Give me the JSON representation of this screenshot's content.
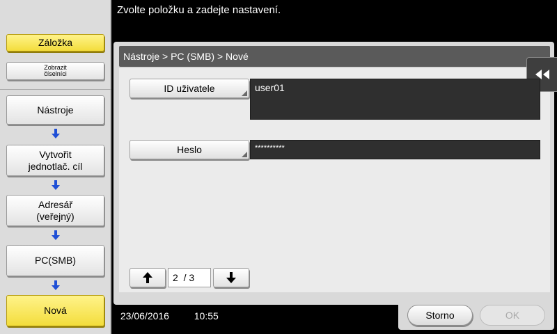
{
  "message": "Zvolte položku a zadejte nastavení.",
  "sidebar": {
    "bookmark_label": "Záložka",
    "keypad_label": "Zobrazit číselníci",
    "flow": [
      "Nástroje",
      "Vytvořit jednotlač. cíl",
      "Adresář (veřejný)",
      "PC(SMB)",
      "Nová"
    ]
  },
  "breadcrumb": "Nástroje > PC (SMB) > Nové",
  "fields": {
    "user_id": {
      "label": "ID uživatele",
      "value": "user01"
    },
    "password": {
      "label": "Heslo",
      "value": "**********"
    }
  },
  "pager": {
    "text": "2  / 3"
  },
  "status": {
    "date": "23/06/2016",
    "time": "10:55"
  },
  "actions": {
    "cancel": "Storno",
    "ok": "OK"
  },
  "colors": {
    "highlight_yellow": "#f3dd3c",
    "arrow_blue": "#1f4fd6",
    "panel_gray": "#d9d9d9"
  }
}
